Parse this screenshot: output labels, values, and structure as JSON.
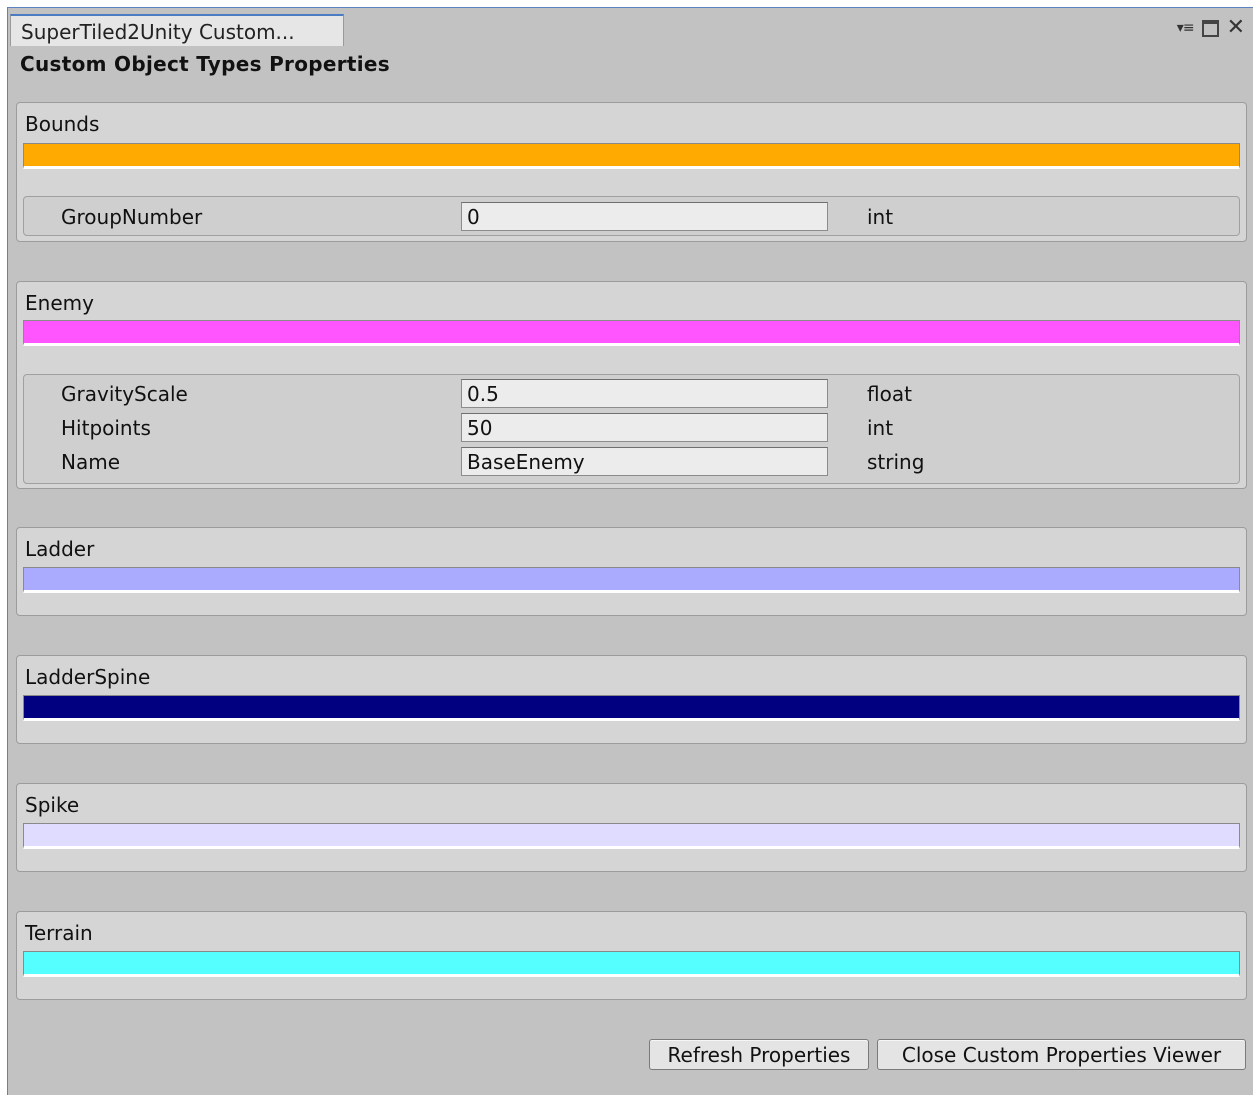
{
  "window": {
    "tab_title": "SuperTiled2Unity Custom...",
    "controls": {
      "menu": "▾≡",
      "close": "✕"
    }
  },
  "heading": "Custom Object Types Properties",
  "groups": [
    {
      "name": "Bounds",
      "color": "#ffaa00",
      "properties": [
        {
          "name": "GroupNumber",
          "value": "0",
          "type": "int"
        }
      ]
    },
    {
      "name": "Enemy",
      "color": "#ff55ff",
      "properties": [
        {
          "name": "GravityScale",
          "value": "0.5",
          "type": "float"
        },
        {
          "name": "Hitpoints",
          "value": "50",
          "type": "int"
        },
        {
          "name": "Name",
          "value": "BaseEnemy",
          "type": "string"
        }
      ]
    },
    {
      "name": "Ladder",
      "color": "#aaaaff",
      "properties": []
    },
    {
      "name": "LadderSpine",
      "color": "#000080",
      "properties": []
    },
    {
      "name": "Spike",
      "color": "#e0dcff",
      "properties": []
    },
    {
      "name": "Terrain",
      "color": "#55ffff",
      "properties": []
    }
  ],
  "buttons": {
    "refresh": "Refresh Properties",
    "close_viewer": "Close Custom Properties Viewer"
  }
}
